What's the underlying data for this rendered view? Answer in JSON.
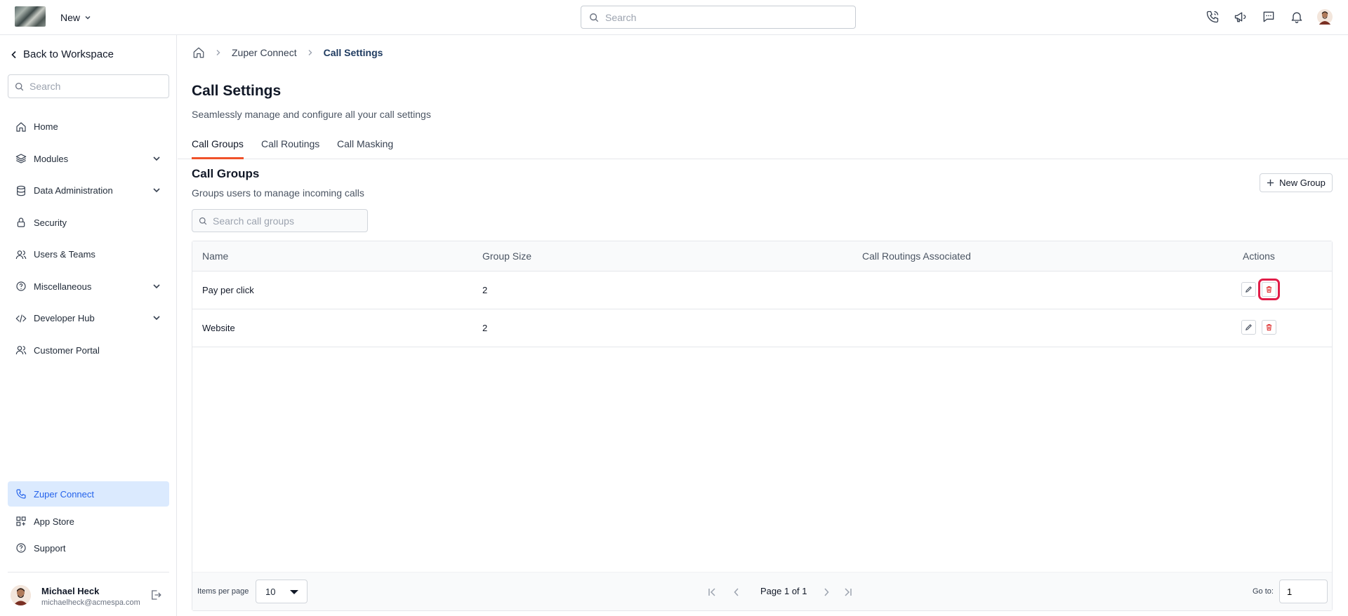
{
  "topbar": {
    "new_label": "New",
    "search_placeholder": "Search",
    "icons": [
      "phone-icon",
      "megaphone-icon",
      "chat-icon",
      "bell-icon",
      "user-avatar"
    ]
  },
  "sidebar": {
    "back_label": "Back to Workspace",
    "search_placeholder": "Search",
    "items": [
      {
        "label": "Home",
        "icon": "home-icon",
        "expandable": false
      },
      {
        "label": "Modules",
        "icon": "layers-icon",
        "expandable": true
      },
      {
        "label": "Data Administration",
        "icon": "database-icon",
        "expandable": true
      },
      {
        "label": "Security",
        "icon": "lock-icon",
        "expandable": false
      },
      {
        "label": "Users & Teams",
        "icon": "users-icon",
        "expandable": false
      },
      {
        "label": "Miscellaneous",
        "icon": "help-circle-icon",
        "expandable": true
      },
      {
        "label": "Developer Hub",
        "icon": "code-icon",
        "expandable": true
      },
      {
        "label": "Customer Portal",
        "icon": "users-icon",
        "expandable": false
      }
    ],
    "bottom_items": [
      {
        "label": "Zuper Connect",
        "icon": "phone-icon",
        "active": true
      },
      {
        "label": "App Store",
        "icon": "grid-icon",
        "active": false
      },
      {
        "label": "Support",
        "icon": "help-circle-icon",
        "active": false
      }
    ],
    "user": {
      "name": "Michael Heck",
      "email": "michaelheck@acmespa.com"
    }
  },
  "breadcrumb": {
    "items": [
      "Zuper Connect",
      "Call Settings"
    ]
  },
  "page": {
    "title": "Call Settings",
    "subtitle": "Seamlessly manage and configure all your call settings"
  },
  "tabs": [
    {
      "label": "Call Groups",
      "active": true
    },
    {
      "label": "Call Routings",
      "active": false
    },
    {
      "label": "Call Masking",
      "active": false
    }
  ],
  "section": {
    "title": "Call Groups",
    "subtitle": "Groups users to manage incoming calls",
    "new_button": "New Group",
    "search_placeholder": "Search call groups"
  },
  "table": {
    "columns": [
      "Name",
      "Group Size",
      "Call Routings Associated",
      "Actions"
    ],
    "rows": [
      {
        "name": "Pay per click",
        "group_size": "2",
        "call_routings": ""
      },
      {
        "name": "Website",
        "group_size": "2",
        "call_routings": ""
      }
    ]
  },
  "pagination": {
    "items_per_page_label": "Items per page",
    "items_per_page": "10",
    "page_info": "Page 1 of 1",
    "goto_label": "Go to:",
    "goto_value": "1"
  },
  "colors": {
    "accent": "#f0522a",
    "active_bg": "#dbeafe",
    "active_text": "#2563eb",
    "delete": "#dc2626",
    "highlight": "#e11d48"
  }
}
